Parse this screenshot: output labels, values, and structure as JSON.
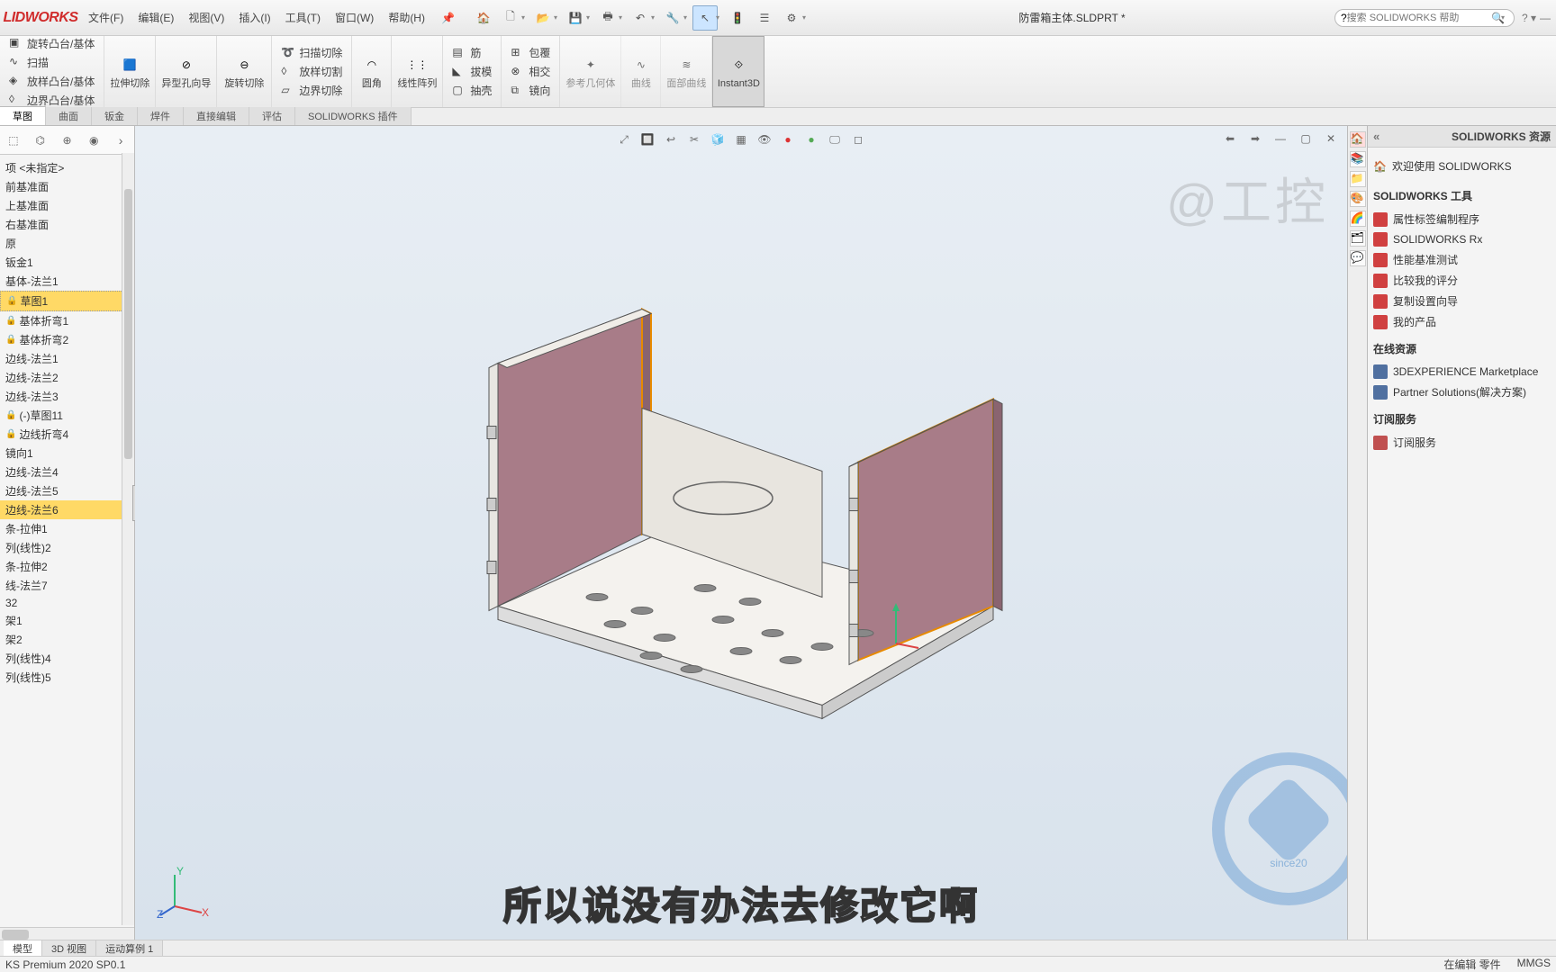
{
  "app": {
    "logo": "LIDWORKS",
    "doc_title": "防雷箱主体.SLDPRT *",
    "search_placeholder": "搜索 SOLIDWORKS 帮助",
    "watermark": "@工控"
  },
  "menus": [
    "文件(F)",
    "编辑(E)",
    "视图(V)",
    "插入(I)",
    "工具(T)",
    "窗口(W)",
    "帮助(H)"
  ],
  "ribbon": {
    "g1": {
      "top": "旋转凸台/基体",
      "mid": "扫描",
      "bot": "放样凸台/基体",
      "ext": "边界凸台/基体"
    },
    "g2": {
      "lbl": "拉伸切除"
    },
    "g3": {
      "lbl": "异型孔向导"
    },
    "g4": {
      "lbl": "旋转切除",
      "a": "扫描切除",
      "b": "放样切割",
      "c": "边界切除"
    },
    "g5": {
      "lbl": "圆角"
    },
    "g6": {
      "lbl": "线性阵列"
    },
    "g7": {
      "a": "筋",
      "b": "拔模",
      "c": "抽壳",
      "a2": "包覆",
      "b2": "相交",
      "c2": "镜向"
    },
    "g8": {
      "lbl": "参考几何体"
    },
    "g9": {
      "lbl": "曲线"
    },
    "g10": {
      "lbl": "面部曲线"
    },
    "g11": {
      "lbl": "Instant3D"
    }
  },
  "doctabs": [
    "草图",
    "曲面",
    "钣金",
    "焊件",
    "直接编辑",
    "评估",
    "SOLIDWORKS 插件"
  ],
  "tree": {
    "items": [
      {
        "t": "项 <未指定>"
      },
      {
        "t": "前基准面"
      },
      {
        "t": "上基准面"
      },
      {
        "t": "右基准面"
      },
      {
        "t": "原"
      },
      {
        "t": "钣金1"
      },
      {
        "t": "基体-法兰1"
      },
      {
        "t": "草图1",
        "lock": true,
        "sel": true
      },
      {
        "t": "基体折弯1",
        "lock": true
      },
      {
        "t": "基体折弯2",
        "lock": true
      },
      {
        "t": "边线-法兰1"
      },
      {
        "t": "边线-法兰2"
      },
      {
        "t": "边线-法兰3"
      },
      {
        "t": "(-)草图11",
        "lock": true
      },
      {
        "t": "边线折弯4",
        "lock": true
      },
      {
        "t": "镜向1"
      },
      {
        "t": "边线-法兰4"
      },
      {
        "t": "边线-法兰5"
      },
      {
        "t": "边线-法兰6",
        "edge6": true
      },
      {
        "t": "条-拉伸1"
      },
      {
        "t": "列(线性)2"
      },
      {
        "t": "条-拉伸2"
      },
      {
        "t": "线-法兰7"
      },
      {
        "t": "32"
      },
      {
        "t": "架1"
      },
      {
        "t": "架2"
      },
      {
        "t": "列(线性)4"
      },
      {
        "t": "列(线性)5"
      }
    ]
  },
  "task": {
    "title": "SOLIDWORKS 资源",
    "welcome": "欢迎使用  SOLIDWORKS",
    "tools_head": "SOLIDWORKS 工具",
    "tools": [
      "属性标签编制程序",
      "SOLIDWORKS Rx",
      "性能基准测试",
      "比较我的评分",
      "复制设置向导",
      "我的产品"
    ],
    "online_head": "在线资源",
    "online": [
      "3DEXPERIENCE Marketplace",
      "Partner Solutions(解决方案)"
    ],
    "sub_head": "订阅服务",
    "sub": [
      "订阅服务"
    ]
  },
  "bottom_tabs": [
    "模型",
    "3D 视图",
    "运动算例 1"
  ],
  "status": {
    "left": "KS Premium 2020 SP0.1",
    "r1": "在编辑 零件",
    "r2": "MMGS"
  },
  "subtitle": "所以说没有办法去修改它啊"
}
